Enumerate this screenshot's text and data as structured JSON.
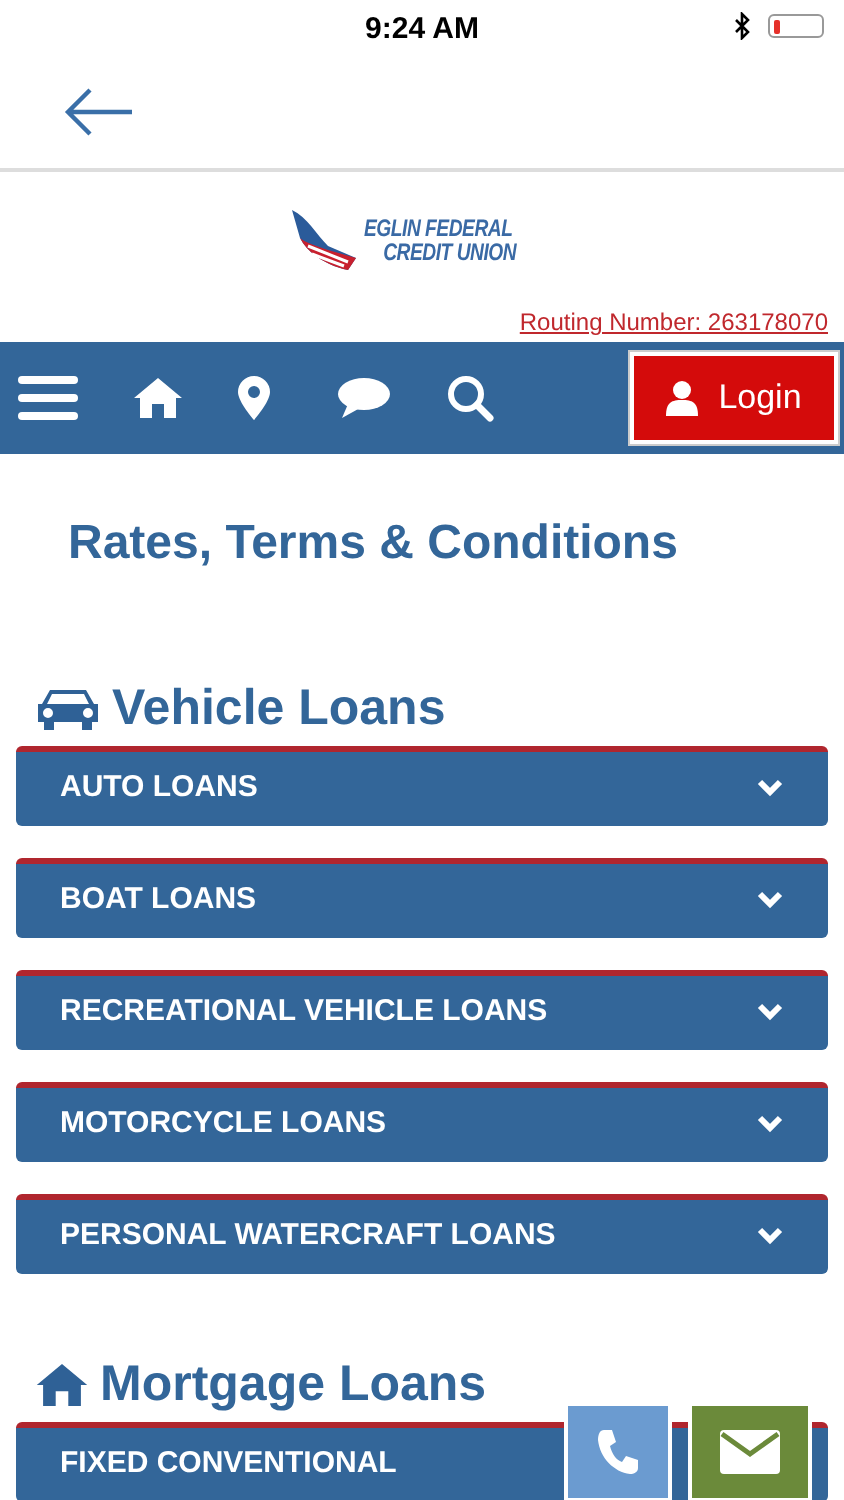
{
  "status_bar": {
    "time": "9:24 AM",
    "battery": {
      "level": 0.15
    }
  },
  "logo": {
    "line_1": "EGLIN FEDERAL",
    "line_2": "CREDIT UNION"
  },
  "routing_link": "Routing Number: 263178070",
  "nav": {
    "login": "Login"
  },
  "page_title": "Rates, Terms & Conditions",
  "sections": [
    {
      "title": "Vehicle Loans",
      "kind": "car",
      "items": [
        {
          "label": "AUTO LOANS",
          "expanded": false
        },
        {
          "label": "BOAT LOANS",
          "expanded": false
        },
        {
          "label": "RECREATIONAL VEHICLE LOANS",
          "expanded": false
        },
        {
          "label": "MOTORCYCLE LOANS",
          "expanded": false
        },
        {
          "label": "PERSONAL WATERCRAFT LOANS",
          "expanded": false
        }
      ]
    },
    {
      "title": "Mortgage Loans",
      "kind": "home",
      "items": [
        {
          "label": "FIXED CONVENTIONAL",
          "expanded": false
        }
      ]
    }
  ]
}
